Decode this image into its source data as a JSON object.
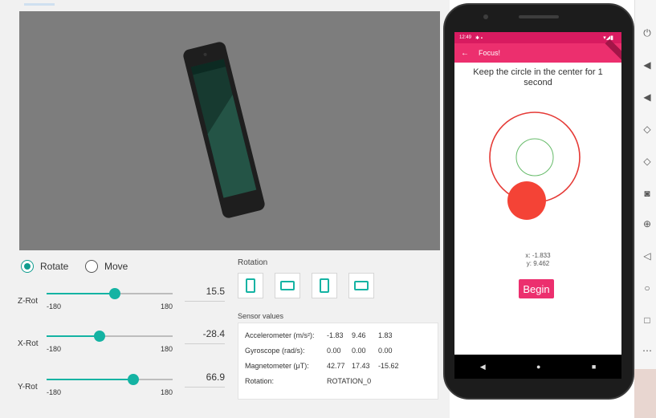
{
  "controls": {
    "mode_options": [
      {
        "label": "Rotate",
        "selected": true
      },
      {
        "label": "Move",
        "selected": false
      }
    ],
    "sliders": [
      {
        "label": "Z-Rot",
        "min": "-180",
        "max": "180",
        "value": "15.5",
        "fraction": 0.543
      },
      {
        "label": "X-Rot",
        "min": "-180",
        "max": "180",
        "value": "-28.4",
        "fraction": 0.421
      },
      {
        "label": "Y-Rot",
        "min": "-180",
        "max": "180",
        "value": "66.9",
        "fraction": 0.686
      }
    ],
    "rotation_title": "Rotation",
    "rotation_buttons": [
      "portrait",
      "landscape",
      "reverse-portrait",
      "reverse-landscape"
    ],
    "sensor_title": "Sensor values",
    "sensors": [
      {
        "name": "Accelerometer (m/s²):",
        "v1": "-1.83",
        "v2": "9.46",
        "v3": "1.83"
      },
      {
        "name": "Gyroscope (rad/s):",
        "v1": "0.00",
        "v2": "0.00",
        "v3": "0.00"
      },
      {
        "name": "Magnetometer (μT):",
        "v1": "42.77",
        "v2": "17.43",
        "v3": "-15.62"
      },
      {
        "name": "Rotation:",
        "v1": "ROTATION_0",
        "v2": "",
        "v3": ""
      }
    ]
  },
  "phone": {
    "status_time": "12:49",
    "app_title": "Focus!",
    "instruction": "Keep the circle in the center for 1 second",
    "x_readout": "x: -1.833",
    "y_readout": "y: 9.462",
    "begin_label": "Begin"
  },
  "colors": {
    "accent": "#14b3a3",
    "app_bar": "#ec2f6e",
    "outer_ring": "#e53935",
    "inner_ring": "#66bb6a",
    "ball": "#f44336"
  }
}
